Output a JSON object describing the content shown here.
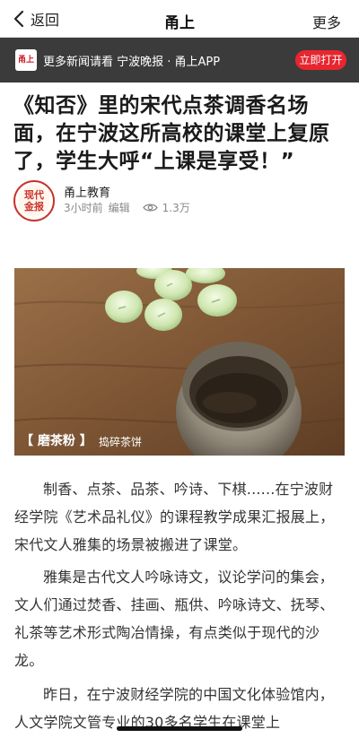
{
  "navbar": {
    "back_label": "返回",
    "title": "甬上",
    "more_label": "更多"
  },
  "app_banner": {
    "logo_text": "甬上",
    "text": "更多新闻请看 宁波晚报 · 甬上APP",
    "open_button": "立即打开",
    "accent_color": "#e8262f"
  },
  "article": {
    "headline": "《知否》里的宋代点茶调香名场面，在宁波这所高校的课堂上复原了，学生大呼“上课是享受！”",
    "author": {
      "avatar_text": [
        "现代",
        "金报"
      ],
      "name": "甬上教育",
      "time": "3小时前",
      "edit_label": "编辑",
      "views": "1.3万"
    },
    "image": {
      "caption_main": "【 磨茶粉 】",
      "caption_sub": "捣碎茶饼"
    },
    "paragraphs": [
      "制香、点茶、品茶、吟诗、下棋......在宁波财经学院《艺术品礼仪》的课程教学成果汇报展上，宋代文人雅集的场景被搬进了课堂。",
      "雅集是古代文人吟咏诗文，议论学问的集会，文人们通过焚香、挂画、瓶供、吟咏诗文、抚琴、礼茶等艺术形式陶冶情操，有点类似于现代的沙龙。",
      "昨日，在宁波财经学院的中国文化体验馆内，人文学院文管专业的30多名学生在课堂上"
    ]
  }
}
